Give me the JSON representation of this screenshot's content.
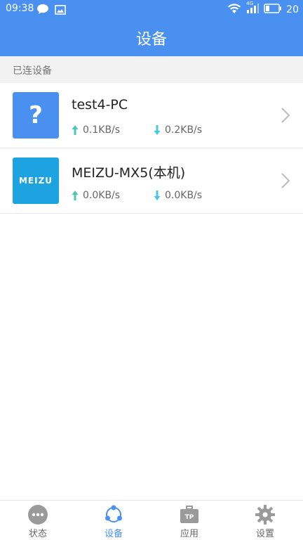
{
  "status_bar": {
    "time": "09:38",
    "battery": "20",
    "network": "4G"
  },
  "header": {
    "title": "设备"
  },
  "section": {
    "label": "已连设备"
  },
  "devices": [
    {
      "name": "test4-PC",
      "upload": "0.1KB/s",
      "download": "0.2KB/s",
      "icon": "question-mark",
      "badge": "?"
    },
    {
      "name": "MEIZU-MX5(本机)",
      "upload": "0.0KB/s",
      "download": "0.0KB/s",
      "icon": "meizu-logo",
      "badge": "MEIZU"
    }
  ],
  "bottom_nav": [
    {
      "label": "状态",
      "icon": "more-dots-icon",
      "active": false
    },
    {
      "label": "设备",
      "icon": "share-nodes-icon",
      "active": true
    },
    {
      "label": "应用",
      "icon": "tp-briefcase-icon",
      "active": false
    },
    {
      "label": "设置",
      "icon": "gear-icon",
      "active": false
    }
  ],
  "colors": {
    "primary": "#4a90f0",
    "meizu": "#1ca3e0",
    "up_arrow": "#48c9b0",
    "down_arrow": "#48c9e0"
  }
}
